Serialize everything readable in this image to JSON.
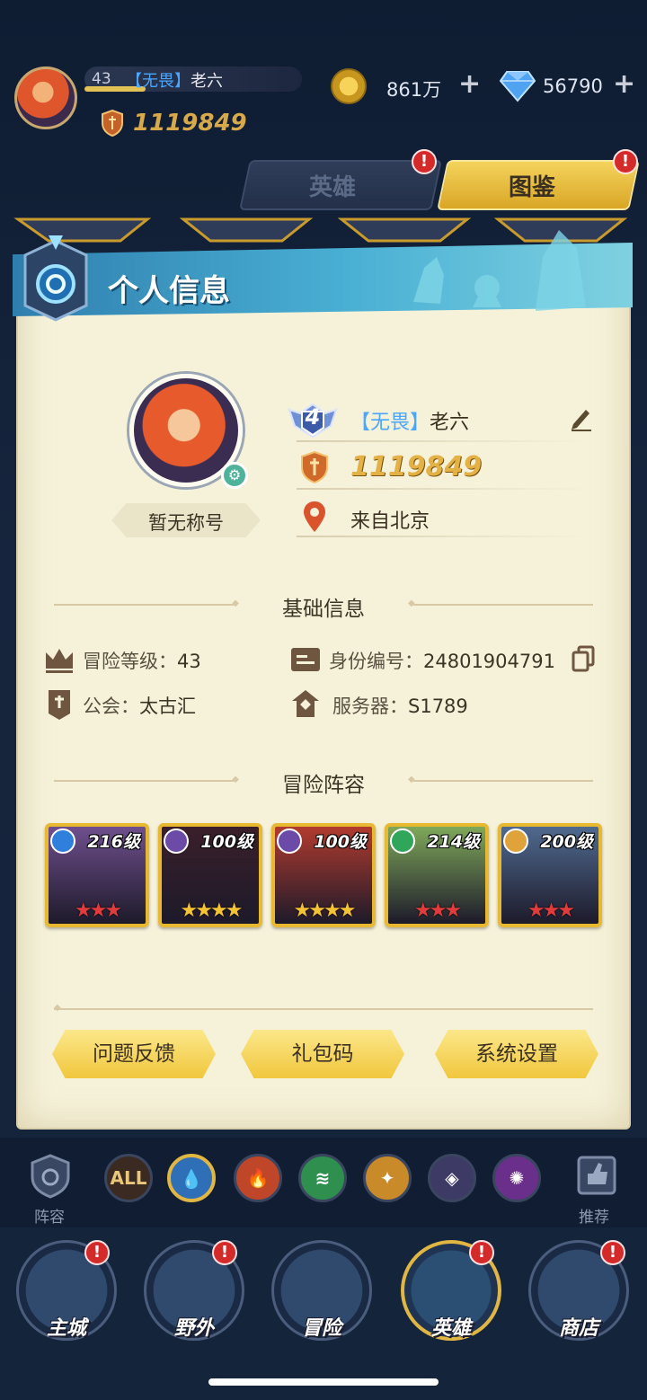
{
  "top_bar": {
    "level": "43",
    "guild": "【无畏】",
    "nickname": "老六",
    "power": "1119849",
    "gold": "861万",
    "gems": "56790",
    "plus": "+"
  },
  "tabs": [
    {
      "label": "英雄",
      "badge": "!"
    },
    {
      "label": "图鉴",
      "badge": "!"
    }
  ],
  "panel": {
    "title": "个人信息",
    "rank": "4",
    "guild": "【无畏】",
    "nickname": "老六",
    "power": "1119849",
    "title_badge": "暂无称号",
    "location": "来自北京"
  },
  "basic_info": {
    "heading": "基础信息",
    "adventure_level": {
      "label": "冒险等级：",
      "value": "43"
    },
    "id_number": {
      "label": "身份编号：",
      "value": "24801904791"
    },
    "guild": {
      "label": "公会：",
      "value": "太古汇"
    },
    "server": {
      "label": "服务器：",
      "value": "S1789"
    }
  },
  "lineup": {
    "heading": "冒险阵容",
    "heroes": [
      {
        "level": "216级",
        "element": "water",
        "elem_color": "#2f7fdc",
        "stars": "★★★",
        "star_color": "#e23b3b",
        "bg": "#6f4f8d"
      },
      {
        "level": "100级",
        "element": "dark",
        "elem_color": "#6b4aa8",
        "stars": "★★★★",
        "star_color": "#f5c233",
        "bg": "#3a1f2a"
      },
      {
        "level": "100级",
        "element": "dark",
        "elem_color": "#6b4aa8",
        "stars": "★★★★",
        "star_color": "#f5c233",
        "bg": "#b23b2e"
      },
      {
        "level": "214级",
        "element": "wind",
        "elem_color": "#2fa65a",
        "stars": "★★★",
        "star_color": "#e23b3b",
        "bg": "#7fa85a"
      },
      {
        "level": "200级",
        "element": "light",
        "elem_color": "#e0a23a",
        "stars": "★★★",
        "star_color": "#e23b3b",
        "bg": "#4f6a8f"
      }
    ]
  },
  "buttons": {
    "feedback": "问题反馈",
    "gift_code": "礼包码",
    "settings": "系统设置"
  },
  "filter": {
    "left_label": "阵容",
    "right_label": "推荐",
    "all_label": "ALL",
    "elements": [
      {
        "name": "water",
        "color": "#2f6fb8"
      },
      {
        "name": "fire",
        "color": "#c0462a"
      },
      {
        "name": "wind",
        "color": "#2f8f4f"
      },
      {
        "name": "light",
        "color": "#c98a2a"
      },
      {
        "name": "dark",
        "color": "#3d3a66"
      },
      {
        "name": "arcane",
        "color": "#6a2f8a"
      }
    ]
  },
  "nav": [
    {
      "label": "主城",
      "badge": "!"
    },
    {
      "label": "野外",
      "badge": "!"
    },
    {
      "label": "冒险",
      "badge": ""
    },
    {
      "label": "英雄",
      "badge": "!"
    },
    {
      "label": "商店",
      "badge": "!"
    }
  ],
  "colors": {
    "accent_gold": "#e3b145",
    "guild_blue": "#4aa7ff",
    "badge_red": "#d42a2a"
  }
}
